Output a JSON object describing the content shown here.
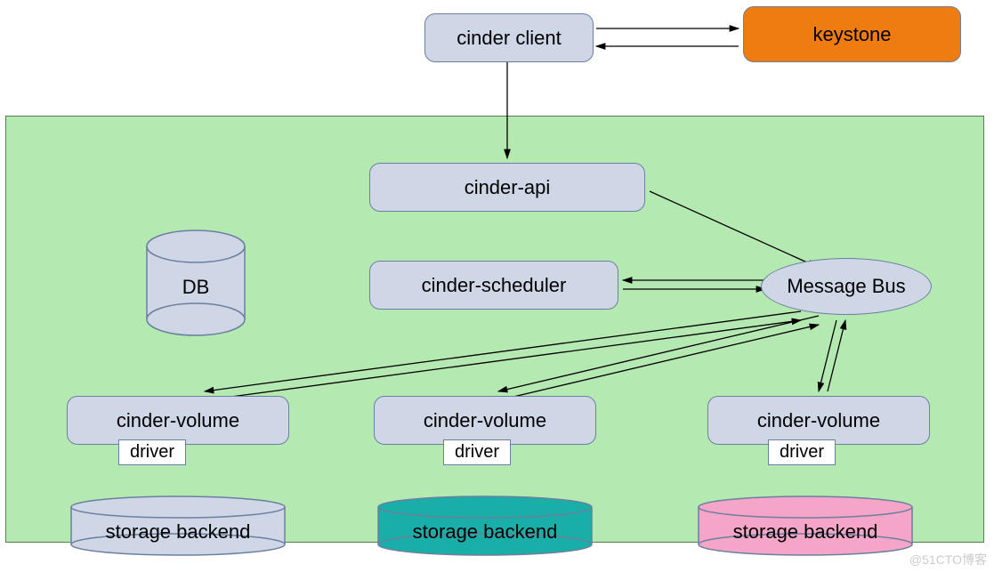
{
  "nodes": {
    "client": "cinder client",
    "keystone": "keystone",
    "api": "cinder-api",
    "scheduler": "cinder-scheduler",
    "message_bus": "Message Bus",
    "db": "DB",
    "volume1": "cinder-volume",
    "volume2": "cinder-volume",
    "volume3": "cinder-volume",
    "driver": "driver",
    "backend1": "storage backend",
    "backend2": "storage backend",
    "backend3": "storage backend"
  },
  "colors": {
    "blue_fill": "#cfd6e6",
    "blue_stroke": "#6b7fa0",
    "orange_fill": "#ee7c11",
    "green_fill": "#b4eab1",
    "teal_fill": "#1aaea8",
    "pink_fill": "#f5a6c8"
  },
  "watermark": "@51CTO博客"
}
